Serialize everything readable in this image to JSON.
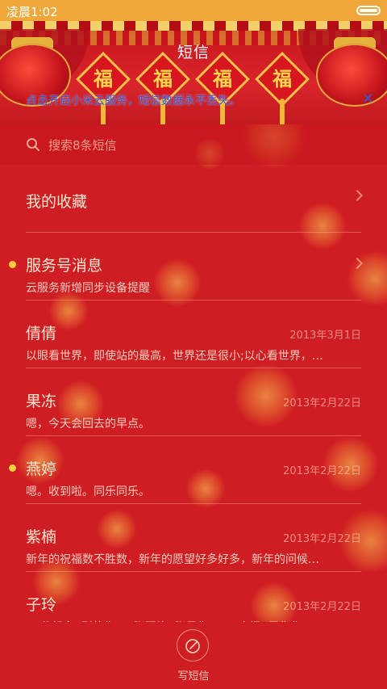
{
  "status_bar": {
    "time": "凌晨1:02"
  },
  "header": {
    "title": "短信",
    "fu_char": "福",
    "banner_text": "点击开启小米云服务，短信数据永不丢失。",
    "close_glyph": "✕"
  },
  "search": {
    "placeholder": "搜索8条短信"
  },
  "list": [
    {
      "name": "我的收藏",
      "preview": "",
      "date": "",
      "unread": false,
      "chevron": true
    },
    {
      "name": "服务号消息",
      "preview": "云服务新增同步设备提醒",
      "date": "",
      "unread": true,
      "chevron": true
    },
    {
      "name": "倩倩",
      "preview": "以眼看世界，即使站的最高，世界还是很小;以心看世界，…",
      "date": "2013年3月1日",
      "unread": false,
      "chevron": false
    },
    {
      "name": "果冻",
      "preview": "嗯，今天会回去的早点。",
      "date": "2013年2月22日",
      "unread": false,
      "chevron": false
    },
    {
      "name": "燕婷",
      "preview": "嗯。收到啦。同乐同乐。",
      "date": "2013年2月22日",
      "unread": true,
      "chevron": false
    },
    {
      "name": "紫楠",
      "preview": "新年的祝福数不胜数，新年的愿望好多好多，新年的问候…",
      "date": "2013年2月22日",
      "unread": false,
      "chevron": false
    },
    {
      "name": "子玲",
      "preview": "10分想念9则的你，8张照片7张是你，6日小杨5是像你，4…",
      "date": "2013年2月22日",
      "unread": false,
      "chevron": false
    }
  ],
  "bottom_bar": {
    "compose_label": "写短信"
  },
  "colors": {
    "background": "#cf1d24",
    "status_bar": "#f0a73a",
    "unread_dot": "#ffce3a",
    "banner_text": "#2e5ad9"
  }
}
